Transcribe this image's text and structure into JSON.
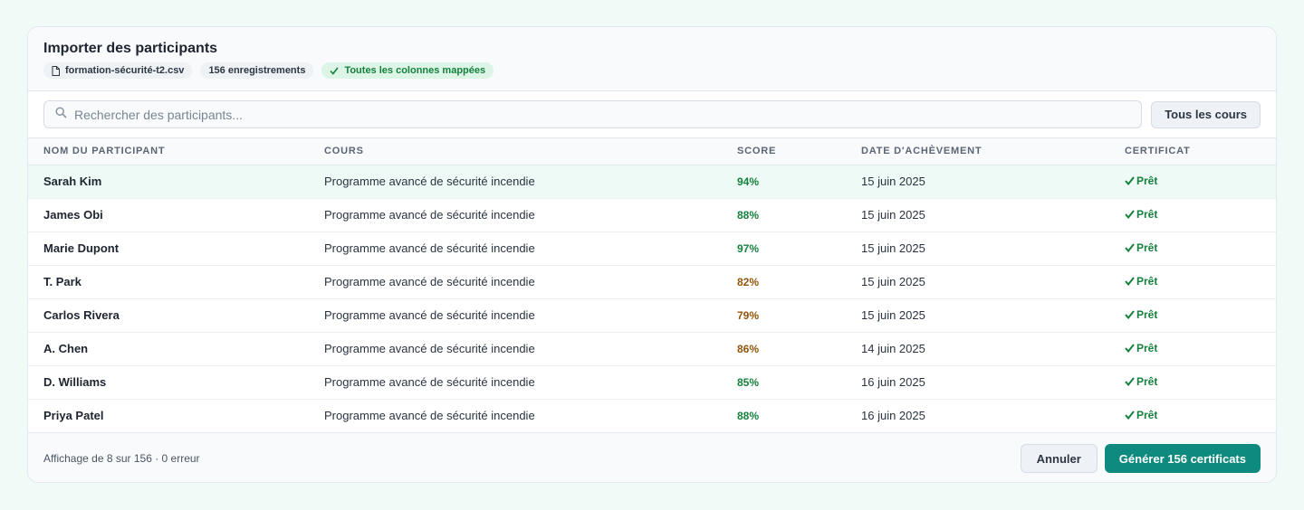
{
  "header": {
    "title": "Importer des participants",
    "file_name": "formation-sécurité-t2.csv",
    "record_count": "156 enregistrements",
    "mapping_status": "Toutes les colonnes mappées"
  },
  "toolbar": {
    "search_placeholder": "Rechercher des participants...",
    "filter_label": "Tous les cours"
  },
  "table": {
    "columns": [
      "Nom du participant",
      "Cours",
      "Score",
      "Date d'achèvement",
      "Certificat"
    ],
    "rows": [
      {
        "name": "Sarah Kim",
        "course": "Programme avancé de sécurité incendie",
        "score": "94%",
        "date": "15 juin 2025",
        "certificate": "Prêt"
      },
      {
        "name": "James Obi",
        "course": "Programme avancé de sécurité incendie",
        "score": "88%",
        "date": "15 juin 2025",
        "certificate": "Prêt"
      },
      {
        "name": "Marie Dupont",
        "course": "Programme avancé de sécurité incendie",
        "score": "97%",
        "date": "15 juin 2025",
        "certificate": "Prêt"
      },
      {
        "name": "T. Park",
        "course": "Programme avancé de sécurité incendie",
        "score": "82%",
        "date": "15 juin 2025",
        "certificate": "Prêt"
      },
      {
        "name": "Carlos Rivera",
        "course": "Programme avancé de sécurité incendie",
        "score": "79%",
        "date": "15 juin 2025",
        "certificate": "Prêt"
      },
      {
        "name": "A. Chen",
        "course": "Programme avancé de sécurité incendie",
        "score": "86%",
        "date": "14 juin 2025",
        "certificate": "Prêt"
      },
      {
        "name": "D. Williams",
        "course": "Programme avancé de sécurité incendie",
        "score": "85%",
        "date": "16 juin 2025",
        "certificate": "Prêt"
      },
      {
        "name": "Priya Patel",
        "course": "Programme avancé de sécurité incendie",
        "score": "88%",
        "date": "16 juin 2025",
        "certificate": "Prêt"
      }
    ]
  },
  "footer": {
    "status": "Affichage de 8 sur 156 · 0 erreur",
    "cancel_label": "Annuler",
    "generate_label": "Générer 156 certificats"
  },
  "colors": {
    "accent": "#0f8a7e",
    "success": "#15803d",
    "warning": "#92560a",
    "highlight_row": "#eefaf5",
    "page_background": "#f0fbf7"
  },
  "icons": {
    "file": "file-icon",
    "check": "check-icon",
    "search": "search-icon"
  }
}
